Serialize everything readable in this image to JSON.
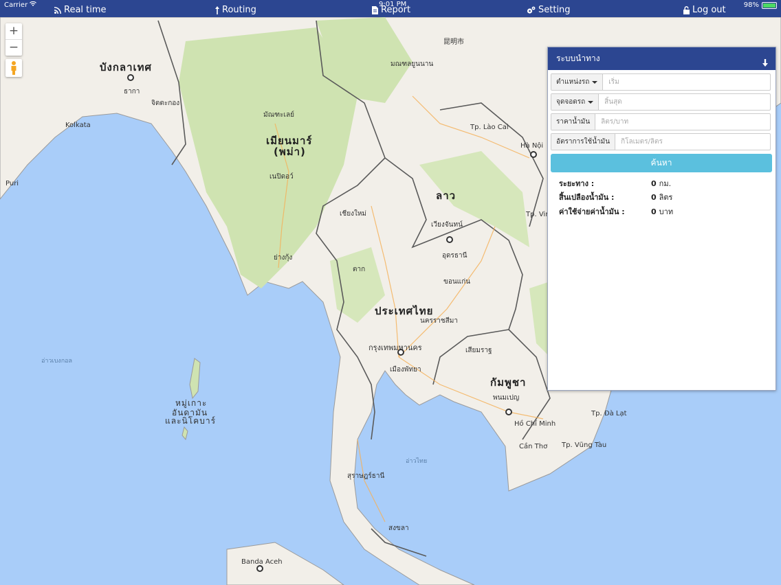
{
  "status_bar": {
    "carrier": "Carrier",
    "time": "9:01 PM",
    "battery": "98%",
    "battery_level": 0.98
  },
  "nav": {
    "realtime": "Real time",
    "routing": "Routing",
    "report": "Report",
    "setting": "Setting",
    "logout": "Log out"
  },
  "map": {
    "zoom_in": "+",
    "zoom_out": "−",
    "countries": {
      "myanmar1": "เมียนมาร์",
      "myanmar2": "(พม่า)",
      "thailand": "ประเทศไทย",
      "laos": "ลาว",
      "cambodia": "กัมพูชา",
      "bangladesh": "บังกลาเทศ"
    },
    "cities": {
      "bangkok": "กรุงเทพมหานคร",
      "yangon": "ย่างกุ้ง",
      "vientiane": "เวียงจันทน์",
      "phnompenh": "พนมเปญ",
      "hcmc": "Hồ Chí Minh",
      "hanoi": "Hà Nội",
      "kolkata": "Kolkata",
      "dhaka": "ธากา",
      "mandalay": "มัณฑะเลย์",
      "naypyidaw": "เนปิดอว์",
      "chiangmai": "เชียงใหม่",
      "khonkaen": "ขอนแก่น",
      "pattaya": "เมืองพัทยา",
      "bandaaceh": "Banda Aceh",
      "kunming": "昆明市",
      "yunnan": "มณฑลยูนนาน",
      "andaman1": "หมู่เกาะ",
      "andaman2": "อันดามัน",
      "andaman3": "และนิโคบาร์",
      "gulf": "อ่าวไทย",
      "bengal": "อ่าวเบงกอล",
      "siemreap": "เสียมราฐ",
      "korat": "นครราชสีมา",
      "udon": "อุดรธานี",
      "tak": "ตาก",
      "suratthani": "สุราษฎร์ธานี",
      "hatyai": "สงขลา",
      "cantho": "Cần Thơ",
      "vungtau": "Tp. Vũng Tàu",
      "dalat": "Tp. Đà Lạt",
      "vinh": "Tp. Vinh",
      "laocai": "Tp. Lào Cai",
      "chittagong": "จิตตะกอง",
      "puri": "Puri"
    }
  },
  "panel": {
    "title": "ระบบนำทาง",
    "vehicle_label": "ตำแหน่งรถ",
    "vehicle_placeholder": "เริ่ม",
    "dest_label": "จุดจอดรถ",
    "dest_placeholder": "สิ้นสุด",
    "fuel_price_label": "ราคาน้ำมัน",
    "fuel_price_placeholder": "ลิตร/บาท",
    "consumption_label": "อัตราการใช้น้ำมัน",
    "consumption_placeholder": "กิโลเมตร/ลิตร",
    "search_label": "ค้นหา",
    "results": [
      {
        "label": "ระยะทาง :",
        "value": "0",
        "unit": "กม."
      },
      {
        "label": "สิ้นเปลืองน้ำมัน :",
        "value": "0",
        "unit": "ลิตร"
      },
      {
        "label": "ค่าใช้จ่ายค่าน้ำมัน :",
        "value": "0",
        "unit": "บาท"
      }
    ]
  },
  "colors": {
    "nav_bg": "#2c4691",
    "search_btn": "#5bc0de",
    "sea": "#a9cdf9",
    "land": "#f2efe9"
  }
}
